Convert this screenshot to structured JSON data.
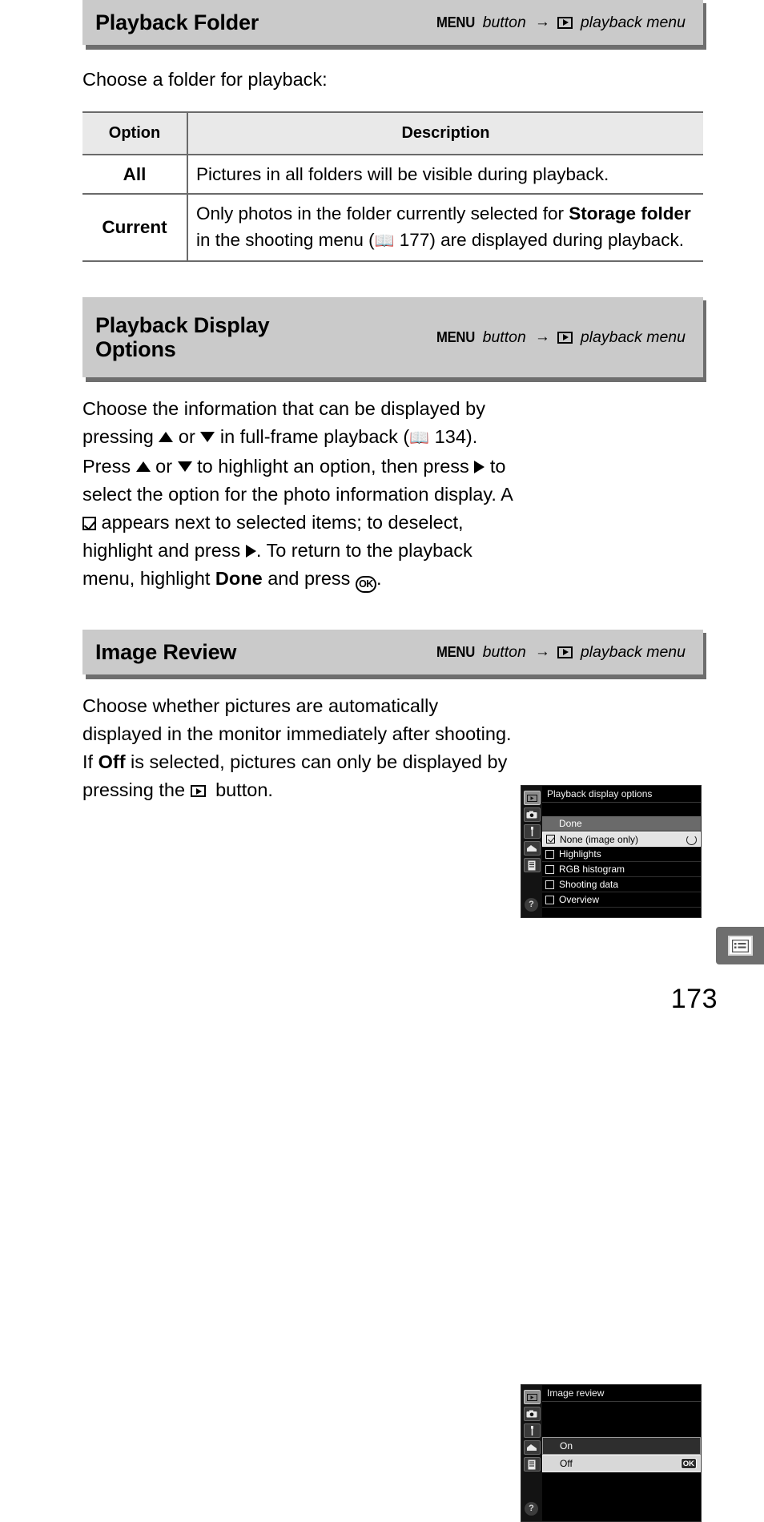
{
  "page": {
    "number": "173",
    "tab_icon": "menu-list-icon"
  },
  "sections": [
    {
      "title": "Playback Folder",
      "path": {
        "menu_word": "MENU",
        "button_word": "button",
        "arrow": "→",
        "icon": "playback-icon",
        "menu_name": "playback menu"
      },
      "intro": "Choose a folder for playback:",
      "table": {
        "headers": [
          "Option",
          "Description"
        ],
        "rows": [
          {
            "option": "All",
            "description_parts": [
              {
                "t": "Pictures in all folders will be visible during playback.",
                "b": false
              }
            ]
          },
          {
            "option": "Current",
            "description_parts": [
              {
                "t": "Only photos in the folder currently selected for ",
                "b": false
              },
              {
                "t": "Storage folder",
                "b": true
              },
              {
                "t": " in the shooting menu (",
                "b": false
              },
              {
                "t": "book-icon",
                "b": false,
                "icon": "book"
              },
              {
                "t": " 177) are displayed during playback.",
                "b": false
              }
            ]
          }
        ]
      }
    },
    {
      "title": "Playback Display\nOptions",
      "path": {
        "menu_word": "MENU",
        "button_word": "button",
        "arrow": "→",
        "icon": "playback-icon",
        "menu_name": "playback menu"
      },
      "body_parts": [
        {
          "t": "Choose the information that can be displayed by pressing ",
          "b": false
        },
        {
          "t": "triangle-up-icon",
          "icon": "tri-up"
        },
        {
          "t": " or ",
          "b": false
        },
        {
          "t": "triangle-down-icon",
          "icon": "tri-down"
        },
        {
          "t": " in full-frame playback (",
          "b": false
        },
        {
          "t": "book-icon",
          "icon": "book"
        },
        {
          "t": " 134).  Press ",
          "b": false
        },
        {
          "t": "triangle-up-icon",
          "icon": "tri-up"
        },
        {
          "t": " or ",
          "b": false
        },
        {
          "t": "triangle-down-icon",
          "icon": "tri-down"
        },
        {
          "t": " to highlight an option, then press ",
          "b": false
        },
        {
          "t": "triangle-right-icon",
          "icon": "tri-right"
        },
        {
          "t": " to select the option for the photo information display.  A ",
          "b": false
        },
        {
          "t": "checkbox-checked-icon",
          "icon": "check"
        },
        {
          "t": " appears next to selected items; to deselect, highlight and press ",
          "b": false
        },
        {
          "t": "triangle-right-icon",
          "icon": "tri-right"
        },
        {
          "t": ". To return to the playback menu, highlight ",
          "b": false
        },
        {
          "t": "Done",
          "b": true
        },
        {
          "t": " and press ",
          "b": false
        },
        {
          "t": "ok-button-icon",
          "icon": "ok"
        },
        {
          "t": ".",
          "b": false
        }
      ],
      "lcd": {
        "title": "Playback display options",
        "sidebar_icons": [
          "playback-icon",
          "camera-icon",
          "wrench-icon",
          "pencil-icon",
          "recent-menu-icon"
        ],
        "help_label": "?",
        "rows": [
          {
            "label": "Done",
            "style": "gray",
            "checkbox": null
          },
          {
            "label": "None (image only)",
            "style": "sel",
            "checkbox": "checked",
            "badge": "refresh-icon"
          },
          {
            "label": "Highlights",
            "style": "normal",
            "checkbox": "unchecked"
          },
          {
            "label": "RGB histogram",
            "style": "normal",
            "checkbox": "unchecked"
          },
          {
            "label": "Shooting data",
            "style": "normal",
            "checkbox": "unchecked"
          },
          {
            "label": "Overview",
            "style": "normal",
            "checkbox": "unchecked"
          }
        ]
      }
    },
    {
      "title": "Image Review",
      "path": {
        "menu_word": "MENU",
        "button_word": "button",
        "arrow": "→",
        "icon": "playback-icon",
        "menu_name": "playback menu"
      },
      "body_parts": [
        {
          "t": "Choose whether pictures are automatically displayed in the monitor immediately after shooting.  If ",
          "b": false
        },
        {
          "t": "Off",
          "b": true
        },
        {
          "t": " is selected, pictures can only be displayed by pressing the ",
          "b": false
        },
        {
          "t": "playback-button-icon",
          "icon": "playbox"
        },
        {
          "t": " button.",
          "b": false
        }
      ],
      "lcd": {
        "title": "Image review",
        "sidebar_icons": [
          "playback-icon",
          "camera-icon",
          "wrench-icon",
          "pencil-icon",
          "recent-menu-icon"
        ],
        "help_label": "?",
        "rows": [
          {
            "label": "On",
            "style": "dark-hi"
          },
          {
            "label": "Off",
            "style": "light-hi",
            "badge": "OK"
          }
        ]
      }
    }
  ],
  "colors": {
    "header_bar": "#cacaca",
    "header_shadow": "#6e6e6e",
    "table_header": "#e9e9e9",
    "table_border": "#6a6a6a",
    "lcd_background": "#000000",
    "page_tab": "#6e6e6e"
  }
}
